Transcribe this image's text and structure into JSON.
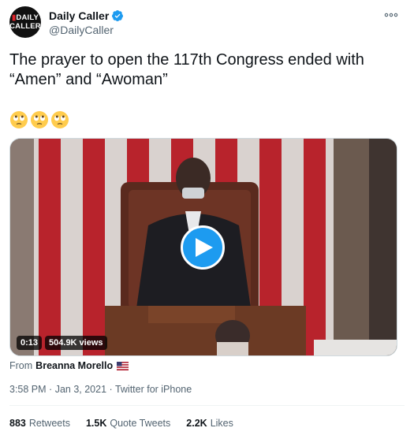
{
  "account": {
    "avatar_line1": "DAILY",
    "avatar_line2": "CALLER",
    "name": "Daily Caller",
    "handle": "@DailyCaller",
    "verified": true
  },
  "tweet": {
    "text": "The prayer to open the 117th Congress ended with\n“Amen” and “Awoman”",
    "emoji": [
      "face-with-rolling-eyes",
      "face-with-rolling-eyes",
      "face-with-rolling-eyes"
    ]
  },
  "media": {
    "duration": "0:13",
    "views": "504.9K views"
  },
  "attribution": {
    "from_label": "From",
    "source_name": "Breanna Morello",
    "flag": "us-flag"
  },
  "meta": {
    "time": "3:58 PM",
    "date": "Jan 3, 2021",
    "client": "Twitter for iPhone",
    "line": "3:58 PM · Jan 3, 2021 · Twitter for iPhone"
  },
  "stats": {
    "retweets_count": "883",
    "retweets_label": "Retweets",
    "quotes_count": "1.5K",
    "quotes_label": "Quote Tweets",
    "likes_count": "2.2K",
    "likes_label": "Likes"
  },
  "colors": {
    "accent": "#1d9bf0",
    "secondary_text": "#536471",
    "primary_text": "#0f1419"
  }
}
